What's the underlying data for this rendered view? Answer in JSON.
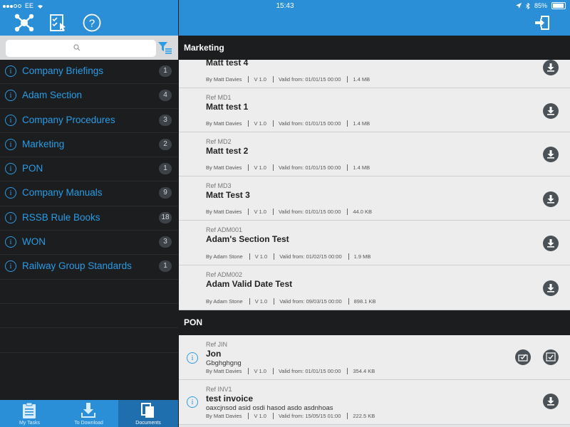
{
  "status_bar": {
    "carrier": "EE",
    "time": "15:43",
    "battery": "85%",
    "battery_level": 0.85
  },
  "sidebar": {
    "toolbar_icons": [
      "network-icon",
      "checklist-icon",
      "help-icon"
    ],
    "search": {
      "placeholder": ""
    },
    "categories": [
      {
        "label": "Company Briefings",
        "count": "1"
      },
      {
        "label": "Adam Section",
        "count": "4"
      },
      {
        "label": "Company Procedures",
        "count": "3"
      },
      {
        "label": "Marketing",
        "count": "2"
      },
      {
        "label": "PON",
        "count": "1"
      },
      {
        "label": "Company Manuals",
        "count": "9"
      },
      {
        "label": "RSSB Rule Books",
        "count": "18"
      },
      {
        "label": "WON",
        "count": "3"
      },
      {
        "label": "Railway Group Standards",
        "count": "1"
      }
    ],
    "tabs": [
      {
        "label": "My Tasks"
      },
      {
        "label": "To Download"
      },
      {
        "label": "Documents"
      }
    ]
  },
  "main": {
    "sections": [
      {
        "title": "Marketing"
      },
      {
        "title": "PON"
      }
    ],
    "documents": [
      {
        "ref": "",
        "title": "Matt test 4",
        "desc": "",
        "author": "By Matt Davies",
        "version": "V 1.0",
        "valid": "Valid from: 01/01/15 00:00",
        "size": "1.4 MB"
      },
      {
        "ref": "Ref MD1",
        "title": "Matt test 1",
        "desc": "",
        "author": "By Matt Davies",
        "version": "V 1.0",
        "valid": "Valid from: 01/01/15 00:00",
        "size": "1.4 MB"
      },
      {
        "ref": "Ref MD2",
        "title": "Matt test 2",
        "desc": "",
        "author": "By Matt Davies",
        "version": "V 1.0",
        "valid": "Valid from: 01/01/15 00:00",
        "size": "1.4 MB"
      },
      {
        "ref": "Ref MD3",
        "title": "Matt Test 3",
        "desc": "",
        "author": "By Matt Davies",
        "version": "V 1.0",
        "valid": "Valid from: 01/01/15 00:00",
        "size": "44.0 KB"
      },
      {
        "ref": "Ref ADM001",
        "title": "Adam's Section Test",
        "desc": "",
        "author": "By Adam Stone",
        "version": "V 1.0",
        "valid": "Valid from: 01/02/15 00:00",
        "size": "1.9 MB"
      },
      {
        "ref": "Ref ADM002",
        "title": "Adam Valid Date Test",
        "desc": "",
        "author": "By Adam Stone",
        "version": "V 1.0",
        "valid": "Valid from: 09/03/15 00:00",
        "size": "898.1 KB"
      },
      {
        "ref": "Ref JIN",
        "title": "Jon",
        "desc": "Gbghghgng",
        "author": "By Matt Davies",
        "version": "V 1.0",
        "valid": "Valid from: 01/01/15 00:00",
        "size": "354.4 KB"
      },
      {
        "ref": "Ref INV1",
        "title": "test invoice",
        "desc": "oaxcjnsod asid osdi hasod asdo asdnhoas",
        "author": "By Matt Davies",
        "version": "V 1.0",
        "valid": "Valid from: 15/05/15 01:00",
        "size": "222.5 KB"
      }
    ]
  }
}
